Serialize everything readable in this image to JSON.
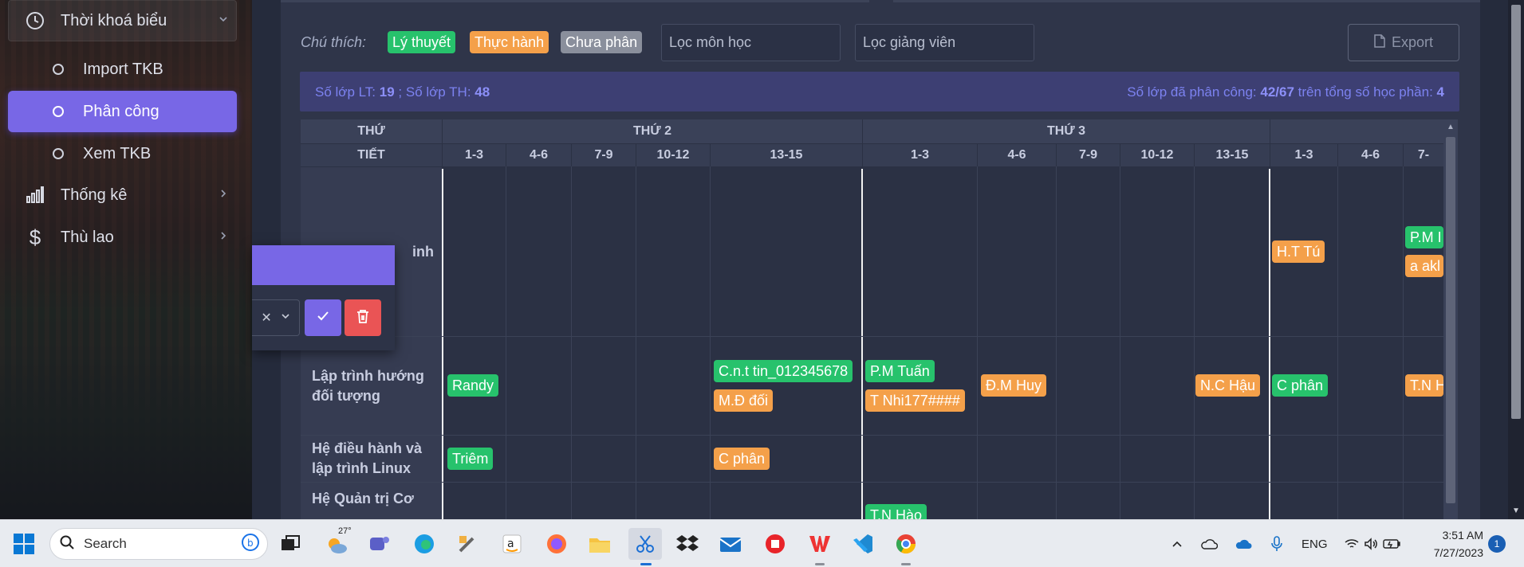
{
  "sidebar": {
    "group_title": "Thời khoá biểu",
    "sub_items": [
      {
        "label": "Import TKB"
      },
      {
        "label": "Phân công"
      },
      {
        "label": "Xem TKB"
      }
    ],
    "items": [
      {
        "label": "Thống kê"
      },
      {
        "label": "Thù lao"
      }
    ]
  },
  "toolbar": {
    "legend_label": "Chú thích:",
    "legend": [
      {
        "label": "Lý thuyết",
        "color": "#27c26c"
      },
      {
        "label": "Thực hành",
        "color": "#f4a04a"
      },
      {
        "label": "Chưa phân",
        "color": "#8a8f9c"
      }
    ],
    "filter_course_placeholder": "Lọc môn học",
    "filter_teacher_placeholder": "Lọc giảng viên",
    "export_label": "Export"
  },
  "stats": {
    "left_prefix": "Số lớp LT: ",
    "lt_count": "19",
    "left_mid": " ; Số lớp TH: ",
    "th_count": "48",
    "right_prefix": "Số lớp đã phân công: ",
    "assigned": "42/67",
    "right_mid": " trên tổng số học phần: ",
    "total_courses": "4"
  },
  "table": {
    "header_day": "THỨ",
    "header_period": "TIẾT",
    "days": [
      "THỨ 2",
      "THỨ 3"
    ],
    "periods": [
      "1-3",
      "4-6",
      "7-9",
      "10-12",
      "13-15",
      "1-3",
      "4-6",
      "7-9",
      "10-12",
      "13-15",
      "1-3",
      "4-6",
      "7-"
    ],
    "rows": [
      {
        "label": "inh"
      },
      {
        "label": "Lập trình hướng đối tượng"
      },
      {
        "label": "Hệ điều hành và lập trình Linux"
      },
      {
        "label": "Hệ Quản trị Cơ"
      }
    ],
    "chips": [
      {
        "text": "H.T Tú",
        "type": "orange"
      },
      {
        "text": "P.M I",
        "type": "green"
      },
      {
        "text": "a akl",
        "type": "orange"
      },
      {
        "text": "Randy",
        "type": "green"
      },
      {
        "text": "C.n.t tin_012345678",
        "type": "green"
      },
      {
        "text": "M.Đ đối",
        "type": "orange"
      },
      {
        "text": "P.M Tuấn",
        "type": "green"
      },
      {
        "text": "T Nhi177####",
        "type": "orange"
      },
      {
        "text": "Đ.M Huy",
        "type": "orange"
      },
      {
        "text": "N.C Hậu",
        "type": "orange"
      },
      {
        "text": "C phân",
        "type": "green"
      },
      {
        "text": "T.N H",
        "type": "orange"
      },
      {
        "text": "Triêm",
        "type": "green"
      },
      {
        "text": "C phân",
        "type": "orange"
      },
      {
        "text": "T.N Hào",
        "type": "green"
      }
    ]
  },
  "taskbar": {
    "search_placeholder": "Search",
    "weather_temp": "27°",
    "lang": "ENG",
    "time": "3:51 AM",
    "date": "7/27/2023",
    "notifications": "1"
  }
}
